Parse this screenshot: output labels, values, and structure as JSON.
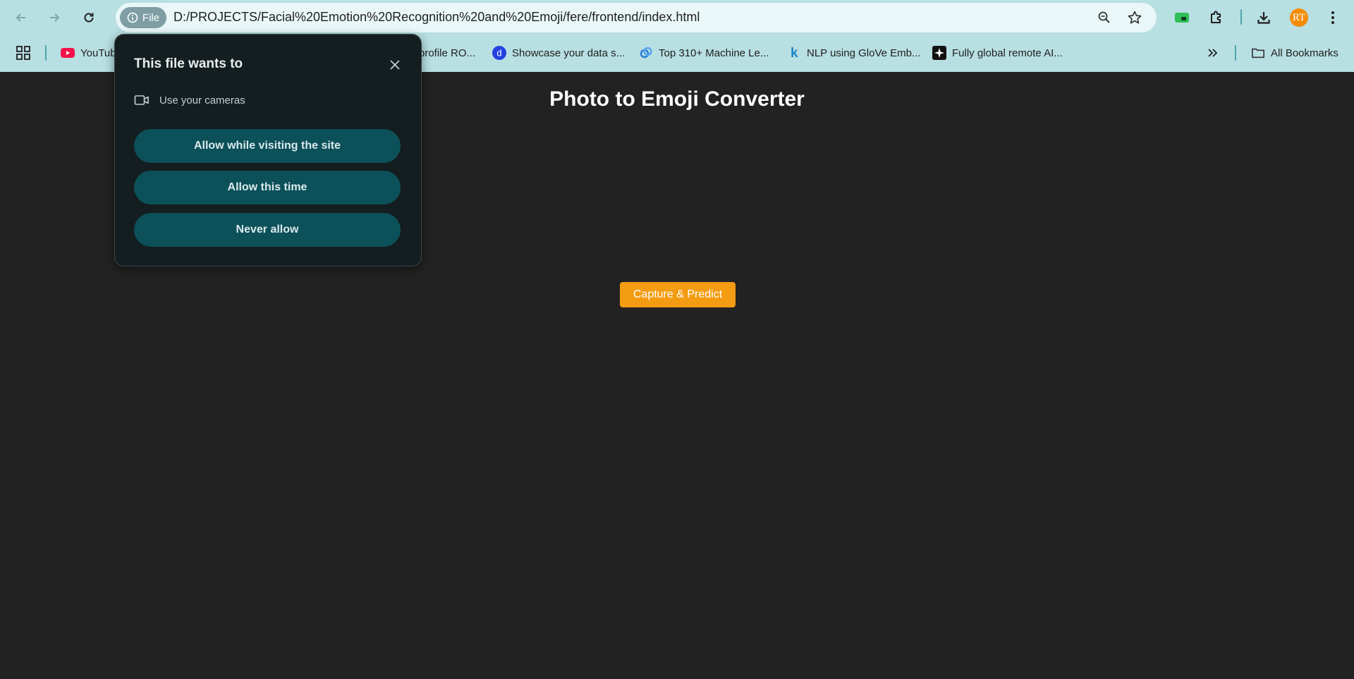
{
  "browser": {
    "address_chip": "File",
    "url": "D:/PROJECTS/Facial%20Emotion%20Recognition%20and%20Emoji/fere/frontend/index.html",
    "profile_initials": "RT",
    "icons": [
      "back-icon",
      "forward-icon",
      "reload-icon",
      "info-icon",
      "zoom-icon",
      "star-icon",
      "extension-badge-icon",
      "puzzle-icon",
      "download-icon",
      "menu-icon"
    ]
  },
  "bookmarks": {
    "items": [
      {
        "label": "YouTub",
        "icon": "youtube-icon"
      },
      {
        "label": "profile RO...",
        "icon": ""
      },
      {
        "label": "Showcase your data s...",
        "icon": "d-icon"
      },
      {
        "label": "Top 310+ Machine Le...",
        "icon": "link-icon"
      },
      {
        "label": "NLP using GloVe Emb...",
        "icon": "k-icon"
      },
      {
        "label": "Fully global remote AI...",
        "icon": "sparkle-icon"
      }
    ],
    "all_bookmarks": "All Bookmarks"
  },
  "page": {
    "title": "Photo to Emoji Converter",
    "capture_button": "Capture & Predict"
  },
  "permission_popup": {
    "title": "This file wants to",
    "permission": "Use your cameras",
    "buttons": [
      "Allow while visiting the site",
      "Allow this time",
      "Never allow"
    ]
  },
  "colors": {
    "toolbar_bg": "#b8dfe2",
    "page_bg": "#222222",
    "capture_button": "#f39c12",
    "popup_bg": "#141d1f",
    "popup_button": "#0c5059",
    "avatar": "#f48c06"
  }
}
